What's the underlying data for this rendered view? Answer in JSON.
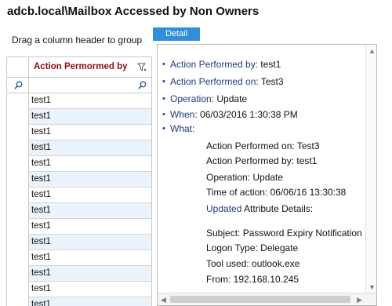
{
  "page": {
    "title": "adcb.local\\Mailbox Accessed by Non Owners",
    "group_hint": "Drag a column header to group"
  },
  "tabs": {
    "detail": "Detail"
  },
  "grid": {
    "column_header": "Action Permormed by",
    "rows": [
      "test1",
      "test1",
      "test1",
      "test1",
      "test1",
      "test1",
      "test1",
      "test1",
      "test1",
      "test1",
      "test1",
      "test1",
      "test1",
      "test1"
    ]
  },
  "detail": {
    "items": [
      {
        "label": "Action Performed by:",
        "value": " test1"
      },
      {
        "label": "Action Performed on:",
        "value": " Test3"
      },
      {
        "label": "Operation:",
        "value": " Update"
      },
      {
        "label": "When:",
        "value": " 06/03/2016 1:30:38 PM"
      },
      {
        "label": "What:",
        "value": ""
      }
    ],
    "what": {
      "action_on": "Action Performed on:  Test3",
      "action_by": "Action Performed by:  test1",
      "operation": "Operation:  Update",
      "time": "Time of action:  06/06/16 13:30:38",
      "updated_label": "Updated",
      "attr_details": " Attribute Details:",
      "subject": "Subject:  Password Expiry Notification",
      "logon": "Logon Type:  Delegate",
      "tool": "Tool used:  outlook.exe",
      "from": "From:  192.168.10.245"
    }
  },
  "colors": {
    "accent": "#2f8fd8",
    "label_blue": "#1f3a7a",
    "header_red": "#8a1010",
    "alt_row": "#eaf3fb"
  }
}
